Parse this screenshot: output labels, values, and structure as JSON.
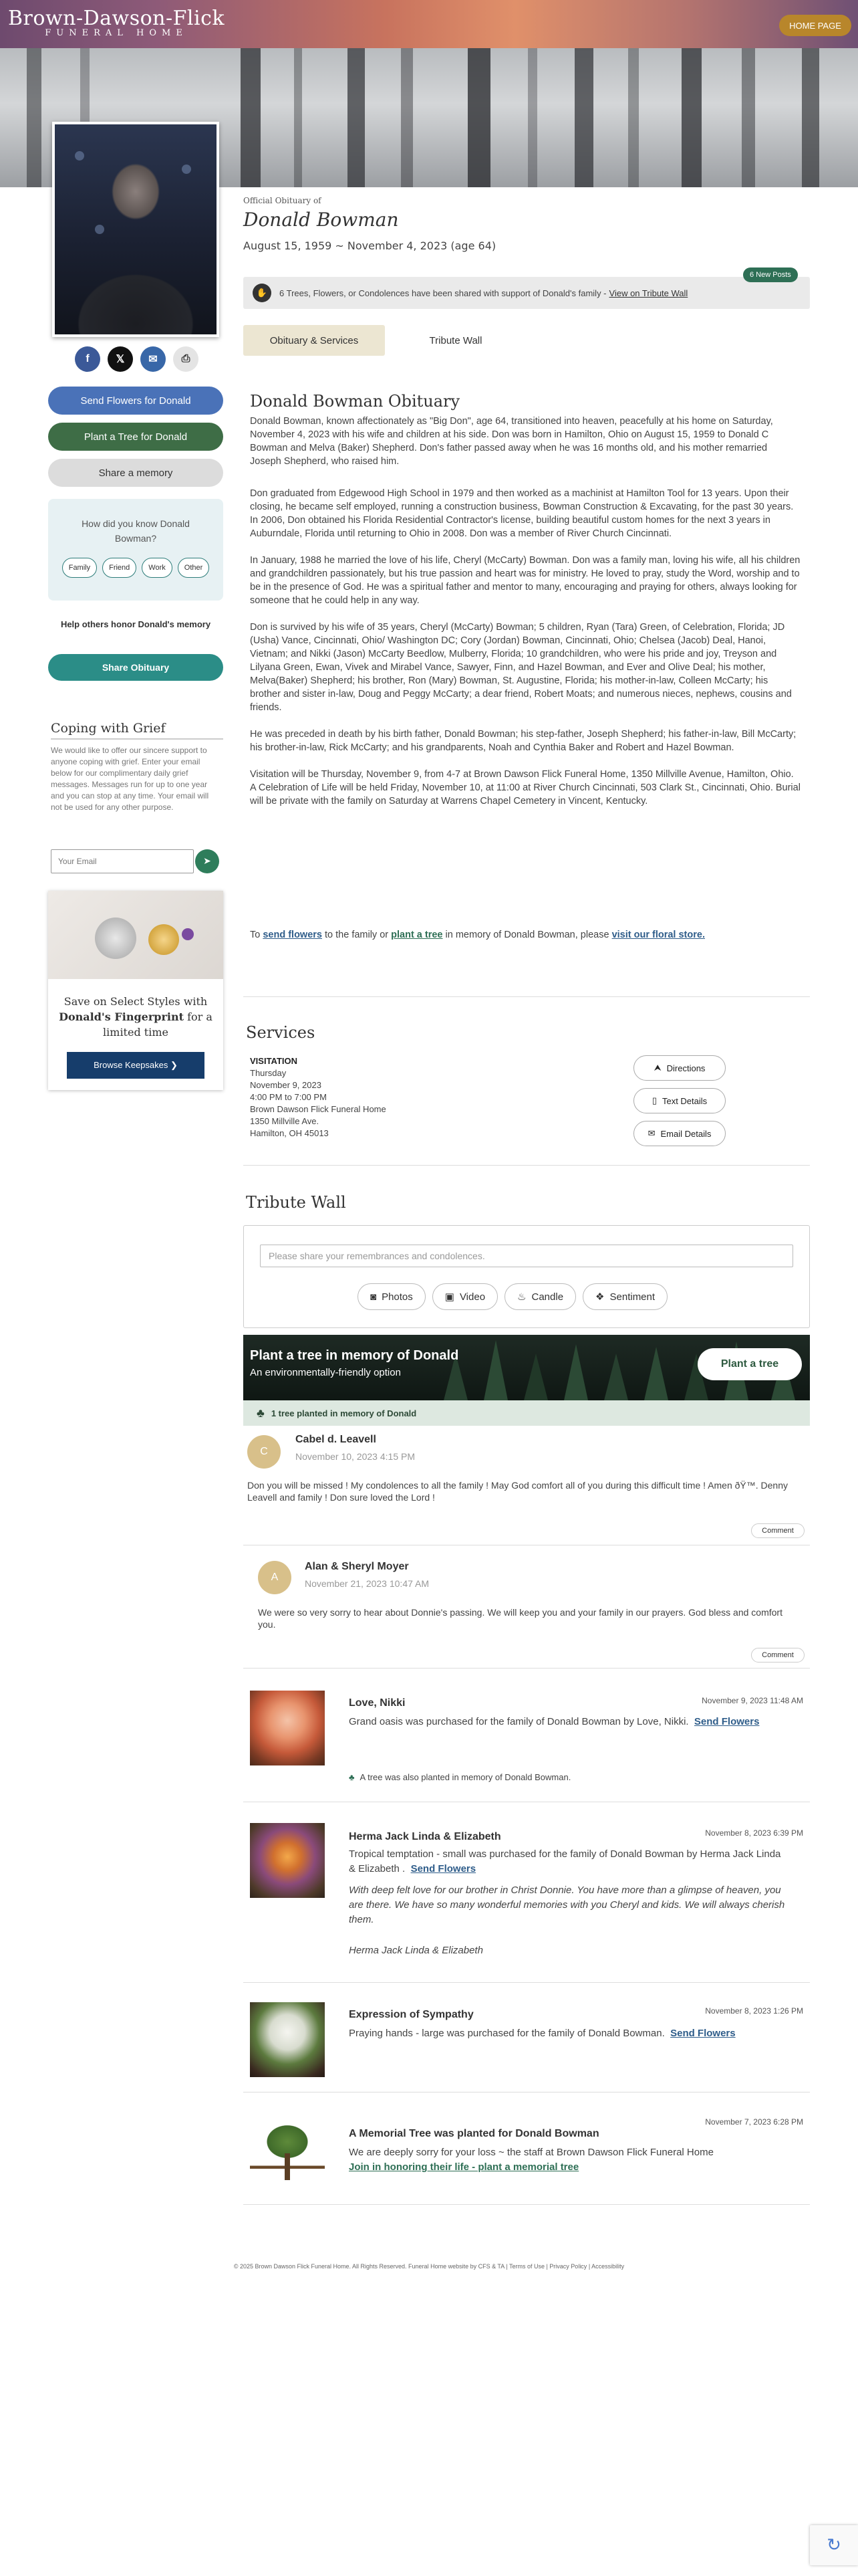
{
  "header": {
    "logo_main": "Brown-Dawson-Flick",
    "logo_sub": "FUNERAL HOME",
    "home_button": "HOME PAGE"
  },
  "sidebar": {
    "share_icons": [
      {
        "icon": "facebook-icon",
        "glyph": "f",
        "color": "#3b5998"
      },
      {
        "icon": "x-icon",
        "glyph": "𝕏",
        "color": "#111111"
      },
      {
        "icon": "email-icon",
        "glyph": "✉",
        "color": "#3867a8"
      },
      {
        "icon": "print-icon",
        "glyph": "⎙",
        "color": "#e4e4e4"
      }
    ],
    "send_flowers": "Send Flowers for Donald",
    "plant_tree": "Plant a Tree for Donald",
    "share_memory": "Share a memory",
    "how_know_question": "How did you know Donald Bowman?",
    "relation_options": [
      "Family",
      "Friend",
      "Work",
      "Other"
    ],
    "help_text": "Help others honor Donald's memory",
    "share_obituary": "Share Obituary",
    "coping_title": "Coping with Grief",
    "coping_text": "We would like to offer our sincere support to anyone coping with grief. Enter your email below for our complimentary daily grief messages. Messages run for up to one year and you can stop at any time. Your email will not be used for any other purpose.",
    "email_placeholder": "Your Email",
    "keepsake_line1": "Save on Select Styles with",
    "keepsake_bold": "Donald's Fingerprint",
    "keepsake_line2": "for a limited time",
    "keepsake_button": "Browse Keepsakes ❯"
  },
  "main": {
    "official": "Official Obituary of",
    "name": "Donald Bowman",
    "dates": "August 15, 1959 ~ November 4, 2023 (age 64)",
    "new_posts": "6 New Posts",
    "shared_text": "6 Trees, Flowers, or Condolences have been shared with support of Donald's family - ",
    "shared_link": "View on Tribute Wall",
    "tabs": [
      "Obituary & Services",
      "Tribute Wall"
    ],
    "obituary_title": "Donald Bowman Obituary",
    "obituary_paragraphs": [
      "Donald Bowman, known affectionately as \"Big Don\", age 64, transitioned into heaven, peacefully at his home on Saturday, November 4, 2023 with his wife and children at his side. Don was born in Hamilton, Ohio on August 15, 1959 to Donald C Bowman and Melva (Baker) Shepherd. Don's father passed away when he was 16 months old, and his mother remarried Joseph Shepherd, who raised him.",
      "Don graduated from Edgewood High School in 1979 and then worked as a machinist at Hamilton Tool for 13 years. Upon their closing, he became self employed, running a construction business, Bowman Construction & Excavating, for the past 30 years. In 2006, Don obtained his Florida Residential Contractor's license, building beautiful custom homes for the next 3 years in Auburndale, Florida until returning to Ohio in 2008. Don was a member of River Church Cincinnati.",
      "In January, 1988 he married the love of his life, Cheryl (McCarty) Bowman. Don was a family man, loving his wife, all his children and grandchildren passionately, but his true passion and heart was for ministry. He loved to pray, study the Word, worship and to be in the presence of God. He was a spiritual father and mentor to many, encouraging and praying for others, always looking for someone that he could help in any way.",
      "Don is survived by his wife of 35 years, Cheryl (McCarty) Bowman; 5 children, Ryan (Tara) Green, of Celebration, Florida; JD (Usha) Vance, Cincinnati, Ohio/ Washington DC; Cory (Jordan) Bowman, Cincinnati, Ohio; Chelsea (Jacob) Deal, Hanoi, Vietnam; and Nikki (Jason) McCarty Beedlow, Mulberry, Florida; 10 grandchildren, who were his pride and joy, Treyson and Lilyana Green, Ewan, Vivek and Mirabel Vance, Sawyer, Finn, and Hazel Bowman, and Ever and Olive Deal; his mother, Melva(Baker) Shepherd; his brother, Ron (Mary) Bowman, St. Augustine, Florida; his mother-in-law, Colleen McCarty; his brother and sister in-law, Doug and Peggy McCarty; a dear friend, Robert Moats; and numerous nieces, nephews, cousins and friends.",
      "He was preceded in death by his birth father, Donald Bowman; his step-father, Joseph Shepherd; his father-in-law, Bill McCarty; his brother-in-law, Rick McCarty; and his grandparents, Noah and Cynthia Baker and Robert and Hazel Bowman.",
      "Visitation will be Thursday, November 9, from 4-7 at Brown Dawson Flick Funeral Home, 1350 Millville Avenue, Hamilton, Ohio. A Celebration of Life will be held Friday, November 10, at 11:00 at River Church Cincinnati, 503 Clark St., Cincinnati, Ohio. Burial will be private with the family on Saturday at Warrens Chapel Cemetery in Vincent, Kentucky."
    ],
    "cta_to": "To ",
    "cta_send": "send flowers",
    "cta_mid": " to the family or ",
    "cta_plant": "plant a tree",
    "cta_memory": " in memory of Donald Bowman, please ",
    "cta_store": "visit our floral store."
  },
  "services": {
    "title": "Services",
    "type": "VISITATION",
    "day": "Thursday",
    "date": "November 9, 2023",
    "time": "4:00 PM to 7:00 PM",
    "venue": "Brown Dawson Flick Funeral Home",
    "street": "1350 Millville Ave.",
    "city": "Hamilton, OH 45013",
    "directions": "Directions",
    "text_details": "Text Details",
    "email_details": "Email Details"
  },
  "tribute": {
    "title": "Tribute Wall",
    "placeholder": "Please share your remembrances and condolences.",
    "actions": [
      {
        "icon": "camera-icon",
        "glyph": "📷",
        "label": "Photos"
      },
      {
        "icon": "video-icon",
        "glyph": "▶",
        "label": "Video"
      },
      {
        "icon": "candle-icon",
        "glyph": "♨",
        "label": "Candle"
      },
      {
        "icon": "gift-icon",
        "glyph": "🎁",
        "label": "Sentiment"
      }
    ],
    "tree_title": "Plant a tree in memory of Donald",
    "tree_sub": "An environmentally-friendly option",
    "tree_button": "Plant a tree",
    "tree_count": "1 tree planted in memory of Donald",
    "comment_label": "Comment",
    "condolences": [
      {
        "initial": "C",
        "name": "Cabel d. Leavell",
        "date": "November 10, 2023 4:15 PM",
        "text": "Don you will be missed ! My condolences to all the family ! May God comfort all of you during this difficult time ! Amen ðŸ™. Denny Leavell and family ! Don sure loved the Lord !"
      },
      {
        "initial": "A",
        "name": "Alan & Sheryl Moyer",
        "date": "November 21, 2023 10:47 AM",
        "text": "We were so very sorry to hear about Donnie's passing. We will keep you and your family in our prayers. God bless and comfort you."
      }
    ],
    "posts": [
      {
        "name": "Love, Nikki",
        "date": "November 9, 2023 11:48 AM",
        "text": "Grand oasis was purchased for the family of Donald Bowman by Love, Nikki.",
        "link": "Send Flowers",
        "note": "A tree was also planted in memory of Donald Bowman."
      },
      {
        "name": "Herma Jack Linda & Elizabeth",
        "date": "November 8, 2023 6:39 PM",
        "text": "Tropical temptation - small was purchased for the family of Donald Bowman by Herma Jack Linda & Elizabeth .",
        "link": "Send Flowers",
        "message": "With deep felt love for our brother in Christ Donnie. You have more than a glimpse of heaven, you are there. We have so many wonderful memories with you Cheryl and kids. We will always cherish them.",
        "signature": "Herma Jack Linda & Elizabeth"
      },
      {
        "name": "Expression of Sympathy",
        "date": "November 8, 2023 1:26 PM",
        "text": "Praying hands - large was purchased for the family of Donald Bowman.",
        "link": "Send Flowers"
      },
      {
        "name": "A Memorial Tree was planted for Donald Bowman",
        "date": "November 7, 2023 6:28 PM",
        "text": "We are deeply sorry for your loss ~ the staff at Brown Dawson Flick Funeral Home",
        "link": "Join in honoring their life - plant a memorial tree"
      }
    ]
  },
  "footer": {
    "text": "© 2025 Brown Dawson Flick Funeral Home. All Rights Reserved. Funeral Home website by CFS & TA | Terms of Use | Privacy Policy | Accessibility"
  }
}
